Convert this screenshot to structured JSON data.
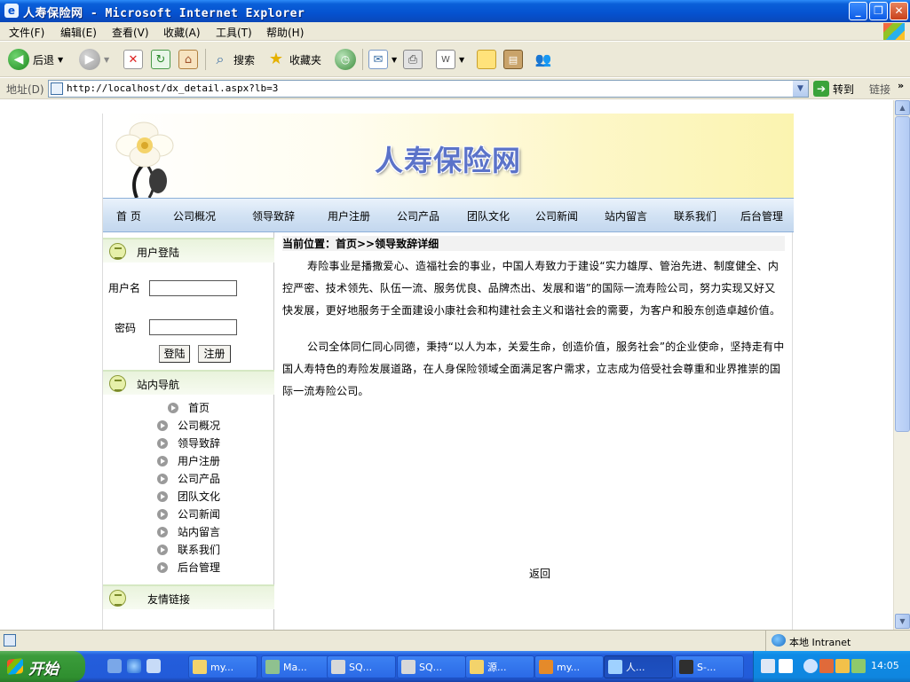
{
  "window": {
    "title": "人寿保险网 - Microsoft Internet Explorer"
  },
  "menu": {
    "items": [
      "文件(F)",
      "编辑(E)",
      "查看(V)",
      "收藏(A)",
      "工具(T)",
      "帮助(H)"
    ]
  },
  "toolbar": {
    "back_label": "后退",
    "search_label": "搜索",
    "favorites_label": "收藏夹"
  },
  "address": {
    "label": "地址(D)",
    "url": "http://localhost/dx_detail.aspx?lb=3",
    "go_label": "转到",
    "links_label": "链接"
  },
  "site": {
    "title": "人寿保险网",
    "nav": [
      "首 页",
      "公司概况",
      "领导致辞",
      "用户注册",
      "公司产品",
      "团队文化",
      "公司新闻",
      "站内留言",
      "联系我们",
      "后台管理"
    ]
  },
  "login": {
    "heading": "用户登陆",
    "username_label": "用户名",
    "password_label": "密码",
    "username_value": "",
    "password_value": "",
    "login_button": "登陆",
    "register_button": "注册"
  },
  "sidenav": {
    "heading": "站内导航",
    "items": [
      "首页",
      "公司概况",
      "领导致辞",
      "用户注册",
      "公司产品",
      "团队文化",
      "公司新闻",
      "站内留言",
      "联系我们",
      "后台管理"
    ]
  },
  "friend_links": {
    "heading": "友情链接"
  },
  "content": {
    "breadcrumb": "当前位置：首页>>领导致辞详细",
    "paragraphs": [
      "寿险事业是播撒爱心、造福社会的事业，中国人寿致力于建设“实力雄厚、管治先进、制度健全、内控严密、技术领先、队伍一流、服务优良、品牌杰出、发展和谐”的国际一流寿险公司，努力实现又好又快发展，更好地服务于全面建设小康社会和构建社会主义和谐社会的需要，为客户和股东创造卓越价值。",
      "公司全体同仁同心同德，秉持“以人为本，关爱生命，创造价值，服务社会”的企业使命，坚持走有中国人寿特色的寿险发展道路，在人身保险领域全面满足客户需求，立志成为倍受社会尊重和业界推崇的国际一流寿险公司。"
    ],
    "back_link": "返回"
  },
  "status": {
    "zone": "本地 Intranet"
  },
  "taskbar": {
    "start_label": "开始",
    "tasks": [
      "my...",
      "Ma...",
      "SQ...",
      "SQ...",
      "源...",
      "my...",
      "人...",
      "S-..."
    ],
    "active_index": 6,
    "clock": "14:05"
  }
}
